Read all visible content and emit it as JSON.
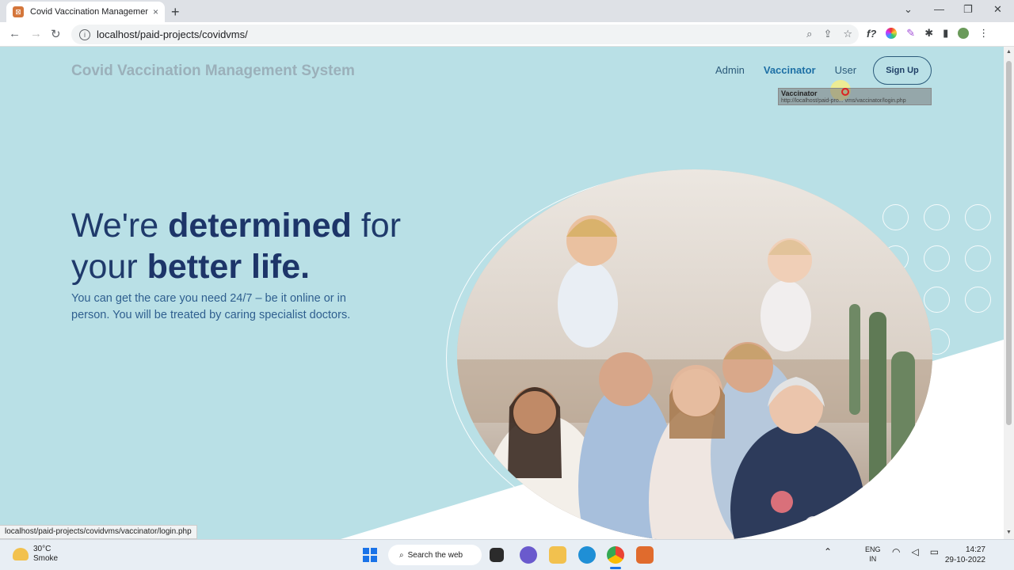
{
  "browser": {
    "tab_title": "Covid Vaccination Management",
    "tab_close": "×",
    "new_tab": "+",
    "url": "localhost/paid-projects/covidvms/",
    "win_min": "—",
    "win_max": "❐",
    "win_close": "✕",
    "chevron": "⌄"
  },
  "site": {
    "brand": "Covid Vaccination Management System",
    "nav": {
      "admin": "Admin",
      "vaccinator": "Vaccinator",
      "user": "User"
    },
    "signup": "Sign Up",
    "tooltip_title": "Vaccinator",
    "tooltip_url": "http://localhost/paid-pro... vms/vaccinator/login.php",
    "hero_line1_a": "We're ",
    "hero_line1_b": "determined",
    "hero_line1_c": " for",
    "hero_line2_a": "your ",
    "hero_line2_b": "better life.",
    "hero_sub": "You can get the care you need 24/7 – be it online or in person. You will be treated by caring specialist doctors.",
    "accent_color": "#1d3569",
    "background_color": "#b9e0e6"
  },
  "status_url": "localhost/paid-projects/covidvms/vaccinator/login.php",
  "taskbar": {
    "temp": "30°C",
    "weather": "Smoke",
    "search": "Search the web",
    "lang1": "ENG",
    "lang2": "IN",
    "time": "14:27",
    "date": "29-10-2022"
  }
}
